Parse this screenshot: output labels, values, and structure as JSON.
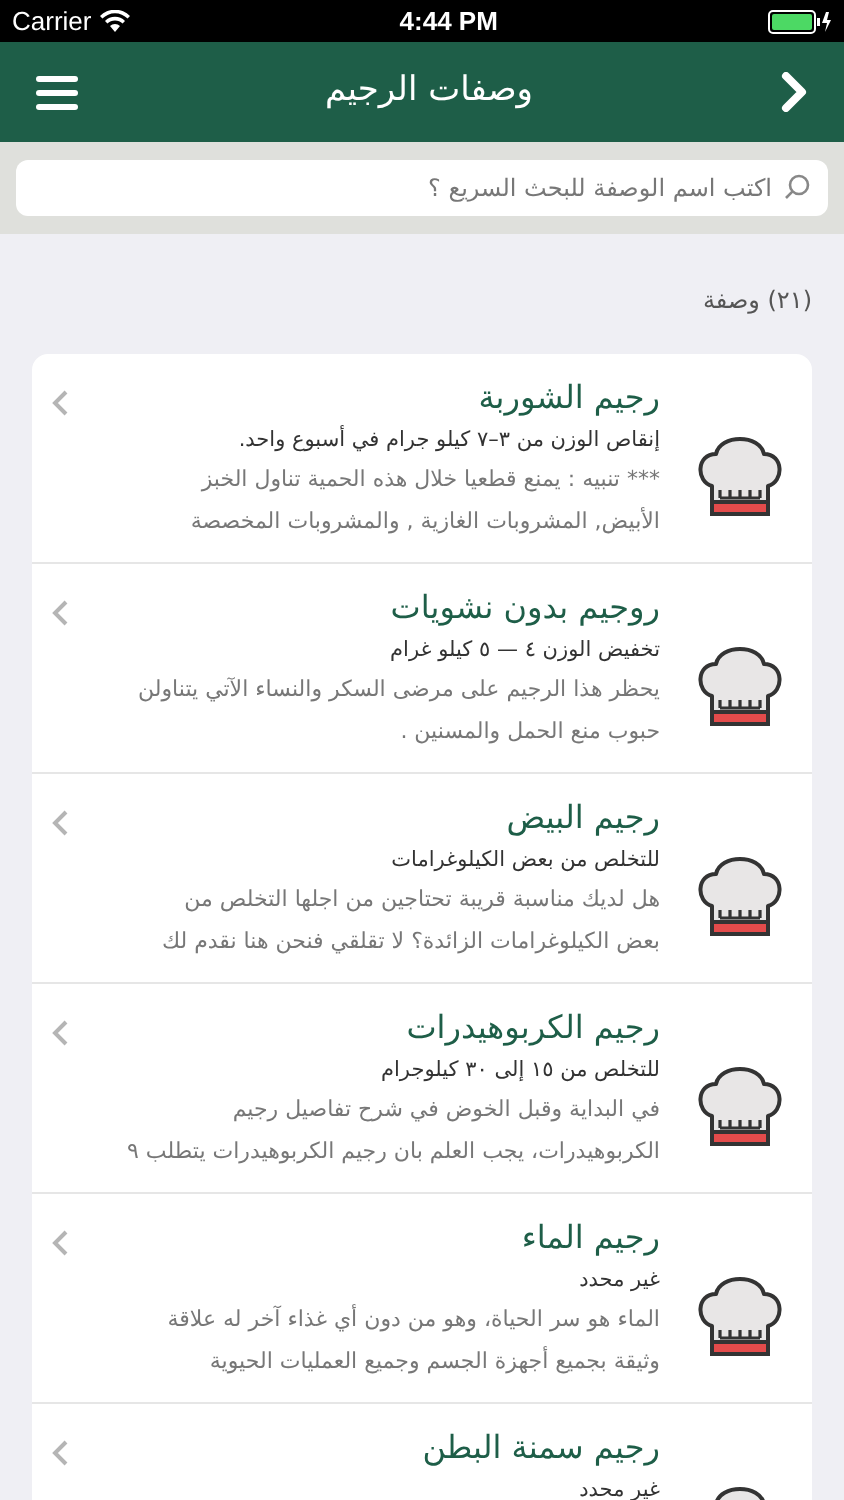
{
  "status_bar": {
    "carrier": "Carrier",
    "time": "4:44 PM"
  },
  "navbar": {
    "title": "وصفات الرجيم"
  },
  "search": {
    "placeholder": "اكتب اسم الوصفة للبحث السريع ؟"
  },
  "count": "(٢١) وصفة",
  "recipes": [
    {
      "title": "رجيم الشوربة",
      "subtitle": "إنقاص الوزن من ٣–٧ كيلو جرام في أسبوع واحد.",
      "description_lines": [
        "*** تنبيه : يمنع قطعيا خلال هذه الحمية تناول الخبز",
        "الأبيض, المشروبات الغازية , والمشروبات المخصصة"
      ]
    },
    {
      "title": "روجيم بدون نشويات",
      "subtitle": "تخفيض الوزن ٤ — ٥ كيلو غرام",
      "description_lines": [
        "يحظر هذا الرجيم على مرضى السكر والنساء الآتي يتناولن",
        "حبوب منع الحمل والمسنين ."
      ]
    },
    {
      "title": "رجيم البيض",
      "subtitle": "للتخلص من بعض الكيلوغرامات",
      "description_lines": [
        "هل لديك مناسبة قريبة تحتاجين من اجلها التخلص من",
        "بعض الكيلوغرامات الزائدة؟ لا تقلقي فنحن هنا نقدم لك"
      ]
    },
    {
      "title": "رجيم الكربوهيدرات",
      "subtitle": "للتخلص من ١٥ إلى ٣٠ كيلوجرام",
      "description_lines": [
        "في البداية وقبل الخوض في شرح تفاصيل رجيم",
        "الكربوهيدرات، يجب العلم بان رجيم الكربوهيدرات يتطلب ٩"
      ]
    },
    {
      "title": "رجيم الماء",
      "subtitle": "غير محدد",
      "description_lines": [
        "الماء هو سر الحياة، وهو من دون أي غذاء آخر له علاقة",
        "وثيقة بجميع أجهزة الجسم وجميع العمليات الحيوية"
      ]
    },
    {
      "title": "رجيم سمنة البطن",
      "subtitle": "غير محدد"
    }
  ]
}
